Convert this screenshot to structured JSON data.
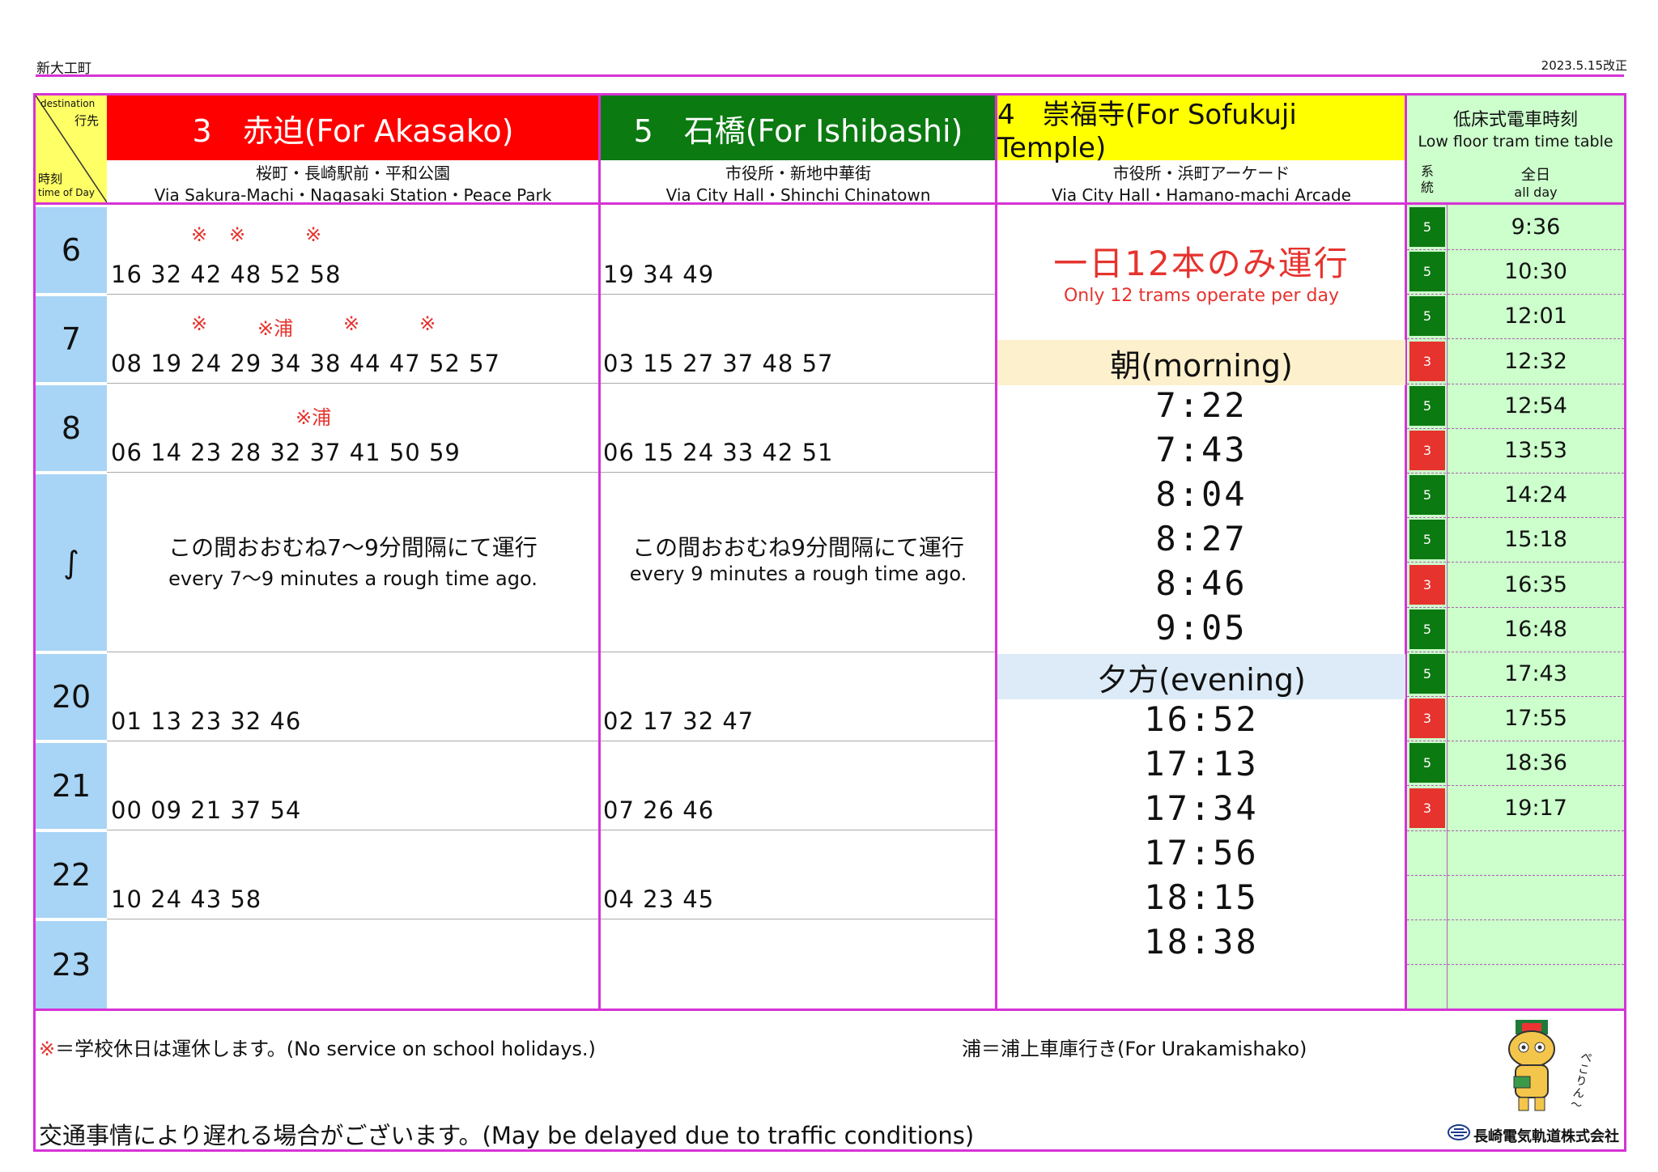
{
  "header": {
    "station": "新大工町",
    "revised": "2023.5.15改正"
  },
  "corner": {
    "dest_en": "destination",
    "dest_jp": "行先",
    "time_jp": "時刻",
    "time_en": "time of Day"
  },
  "routes": [
    {
      "head": "3　赤迫(For Akasako)",
      "sub_jp": "桜町・長崎駅前・平和公園",
      "sub_en": "Via Sakura-Machi・Nagasaki Station・Peace Park",
      "color": "#ff0000"
    },
    {
      "head": "5　石橋(For Ishibashi)",
      "sub_jp": "市役所・新地中華街",
      "sub_en": "Via City Hall・Shinchi Chinatown",
      "color": "#0b7a11"
    },
    {
      "head": "4　崇福寺(For Sofukuji Temple)",
      "sub_jp": "市役所・浜町アーケード",
      "sub_en": "Via City Hall・Hamano-machi Arcade",
      "color": "#ffff00"
    }
  ],
  "low_floor": {
    "title_jp": "低床式電車時刻",
    "title_en": "Low floor tram time table",
    "col_route_jp": "系統",
    "col_all_jp": "全日",
    "col_all_en": "all day"
  },
  "hours": [
    "6",
    "7",
    "8",
    "∫",
    "20",
    "21",
    "22",
    "23"
  ],
  "route3": {
    "h6": "16 32 42 48 52 58",
    "h7": "08 19 24 29 34 38 44 47 52 57",
    "h8": "06 14 23 28 32 37 41 50 59",
    "interval_jp": "この間おおむね7～9分間隔にて運行",
    "interval_en": "every 7～9 minutes a rough time ago.",
    "h20": "01 13 23 32 46",
    "h21": "00 09 21 37 54",
    "h22": "10 24 43 58",
    "h23": "",
    "marks": {
      "m6a": "※",
      "m6b": "※",
      "m6c": "※",
      "m7a": "※",
      "m7b": "※浦",
      "m7c": "※",
      "m7d": "※",
      "m8a": "※浦"
    }
  },
  "route5": {
    "h6": "19 34 49",
    "h7": "03 15 27 37 48 57",
    "h8": "06 15 24 33 42 51",
    "interval_jp": "この間おおむね9分間隔にて運行",
    "interval_en": "every 9 minutes a rough time ago.",
    "h20": "02 17 32 47",
    "h21": "07 26 46",
    "h22": "04 23 45",
    "h23": ""
  },
  "route4": {
    "notice_jp": "一日12本のみ運行",
    "notice_en": "Only 12 trams operate per day",
    "morning_label": "朝(morning)",
    "morning": [
      "7:22",
      "7:43",
      "8:04",
      "8:27",
      "8:46",
      "9:05"
    ],
    "evening_label": "夕方(evening)",
    "evening": [
      "16:52",
      "17:13",
      "17:34",
      "17:56",
      "18:15",
      "18:38"
    ]
  },
  "low_floor_rows": [
    {
      "route": "5",
      "time": "9:36"
    },
    {
      "route": "5",
      "time": "10:30"
    },
    {
      "route": "5",
      "time": "12:01"
    },
    {
      "route": "3",
      "time": "12:32"
    },
    {
      "route": "5",
      "time": "12:54"
    },
    {
      "route": "3",
      "time": "13:53"
    },
    {
      "route": "5",
      "time": "14:24"
    },
    {
      "route": "5",
      "time": "15:18"
    },
    {
      "route": "3",
      "time": "16:35"
    },
    {
      "route": "5",
      "time": "16:48"
    },
    {
      "route": "5",
      "time": "17:43"
    },
    {
      "route": "3",
      "time": "17:55"
    },
    {
      "route": "5",
      "time": "18:36"
    },
    {
      "route": "3",
      "time": "19:17"
    }
  ],
  "colors": {
    "route3": "#e6332e",
    "route5": "#0b7a11",
    "low_bg": "#ccffcc",
    "hour_bg": "#a8d4f5",
    "morning_bg": "#fdf0cc",
    "evening_bg": "#dcebf7",
    "border": "#d633d6"
  },
  "footer": {
    "note_mark": "※＝学校休日は運休します。(No service on school holidays.)",
    "note_ura": "浦＝浦上車庫行き(For Urakamishako)",
    "delay": "交通事情により遅れる場合がございます。(May be delayed due to traffic conditions)",
    "company": "長崎電気軌道株式会社",
    "mascot_text": "ぺこりん～"
  }
}
